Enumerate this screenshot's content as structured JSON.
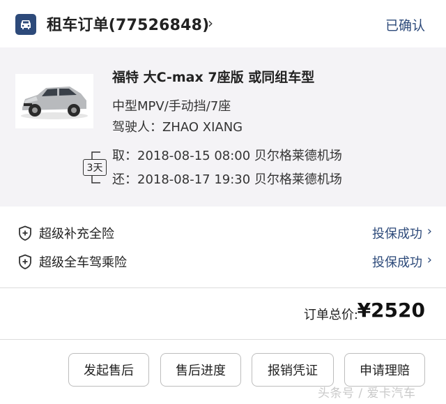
{
  "header": {
    "title": "租车订单(77526848)",
    "chevron": "›",
    "status": "已确认",
    "icon": "car-icon"
  },
  "vehicle": {
    "name": "福特 大C-max 7座版 或同组车型",
    "spec": "中型MPV/手动挡/7座",
    "driver": "驾驶人：ZHAO XIANG",
    "photo": "silver-mpv-car-photo"
  },
  "rental": {
    "days": "3天",
    "pickup": "取：2018-08-15 08:00 贝尔格莱德机场",
    "return": "还：2018-08-17 19:30 贝尔格莱德机场"
  },
  "insurance": [
    {
      "name": "超级补充全险",
      "status": "投保成功",
      "chevron": "›",
      "icon": "shield-plus-icon"
    },
    {
      "name": "超级全车驾乘险",
      "status": "投保成功",
      "chevron": "›",
      "icon": "shield-plus-icon"
    }
  ],
  "order_total": {
    "label": "订单总价:",
    "value": "¥2520"
  },
  "actions": {
    "after_sale": "发起售后",
    "progress": "售后进度",
    "reimburse": "报销凭证",
    "claim": "申请理赔"
  },
  "watermark": "头条号 / 爱卡汽车",
  "colors": {
    "accent": "#2d4a7a",
    "detail_bg": "#f4f3f6",
    "divider": "#dcdcdc"
  }
}
